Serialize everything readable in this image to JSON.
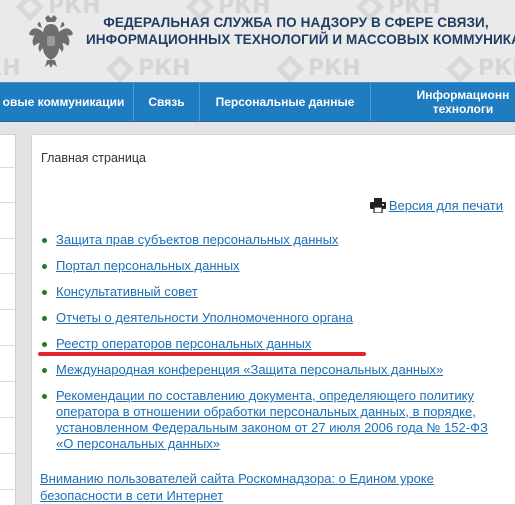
{
  "header": {
    "title_line1": "ФЕДЕРАЛЬНАЯ СЛУЖБА ПО НАДЗОРУ В СФЕРЕ СВЯЗИ,",
    "title_line2": "ИНФОРМАЦИОННЫХ ТЕХНОЛОГИЙ И МАССОВЫХ КОММУНИКАЦИЙ",
    "watermark": "РКН",
    "emblem_icon": "double-headed-eagle-icon"
  },
  "nav": {
    "items": [
      {
        "label": "овые коммуникации"
      },
      {
        "label": "Связь"
      },
      {
        "label": "Персональные данные"
      },
      {
        "label_line1": "Информационн",
        "label_line2": "технологи"
      }
    ]
  },
  "main": {
    "breadcrumb": "Главная страница",
    "print_label": "Версия для печати",
    "print_icon": "printer-icon",
    "links": [
      {
        "label": "Защита прав субъектов персональных данных"
      },
      {
        "label": "Портал персональных данных"
      },
      {
        "label": "Консультативный совет"
      },
      {
        "label": "Отчеты о деятельности Уполномоченного органа"
      },
      {
        "label": "Реестр операторов персональных данных"
      },
      {
        "label": "Международная конференция «Защита персональных данных»"
      },
      {
        "label": "Рекомендации по составлению документа, определяющего политику оператора в отношении обработки персональных данных, в порядке, установленном Федеральным законом от 27 июля 2006 года № 152-ФЗ «О персональных данных»"
      }
    ],
    "news_link": "Вниманию пользователей сайта Роскомнадзора: о Едином уроке безопасности в сети Интернет"
  },
  "colors": {
    "nav_bg": "#1f7cc0",
    "title_color": "#1f3c63",
    "link_color": "#1f6fb5",
    "bullet_color": "#1e7a2c",
    "highlight_underline": "#e0252b"
  }
}
